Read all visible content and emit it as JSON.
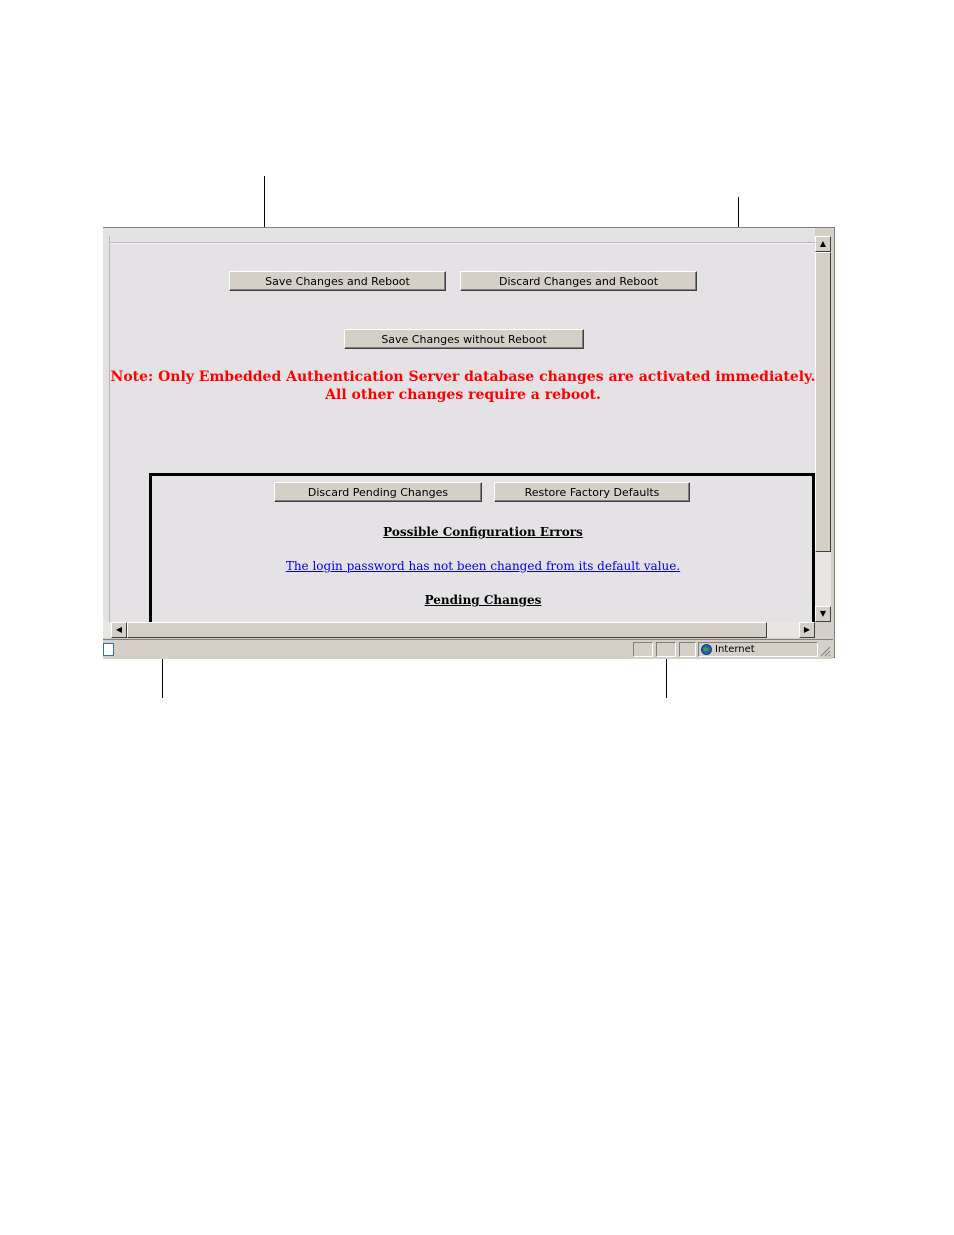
{
  "toolbar": {
    "save_reboot_label": "Save Changes and Reboot",
    "discard_reboot_label": "Discard Changes and Reboot",
    "save_no_reboot_label": "Save Changes without Reboot"
  },
  "note": {
    "line1": "Note: Only Embedded Authentication Server database changes are activated immediately.",
    "line2": "All other changes require a reboot."
  },
  "pending_panel": {
    "discard_pending_label": "Discard Pending Changes",
    "restore_defaults_label": "Restore Factory Defaults",
    "config_errors_heading": "Possible Configuration Errors",
    "error_link": "The login password has not been changed from its default value.",
    "pending_heading": "Pending Changes"
  },
  "statusbar": {
    "zone_label": "Internet",
    "zone_icon": "globe-icon",
    "page_icon": "page-icon"
  },
  "colors": {
    "note_text": "#ff0000",
    "link_text": "#0000ee",
    "page_bg": "#e5e2e6"
  }
}
